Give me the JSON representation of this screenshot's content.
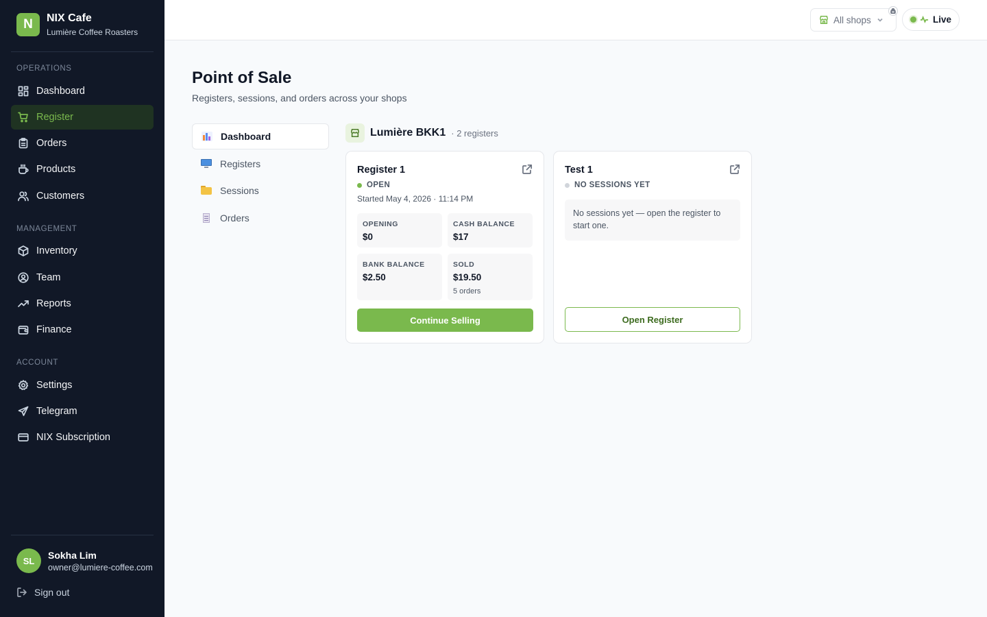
{
  "brand": {
    "logo_letter": "N",
    "name": "NIX Cafe",
    "subtitle": "Lumière Coffee Roasters"
  },
  "sidebar": {
    "sections": [
      {
        "label": "OPERATIONS",
        "items": [
          {
            "label": "Dashboard",
            "icon": "dashboard-icon"
          },
          {
            "label": "Register",
            "icon": "cart-icon",
            "active": true
          },
          {
            "label": "Orders",
            "icon": "clipboard-icon"
          },
          {
            "label": "Products",
            "icon": "coffee-icon"
          },
          {
            "label": "Customers",
            "icon": "users-icon"
          }
        ]
      },
      {
        "label": "MANAGEMENT",
        "items": [
          {
            "label": "Inventory",
            "icon": "box-icon"
          },
          {
            "label": "Team",
            "icon": "user-circle-icon"
          },
          {
            "label": "Reports",
            "icon": "trend-icon"
          },
          {
            "label": "Finance",
            "icon": "wallet-icon"
          }
        ]
      },
      {
        "label": "ACCOUNT",
        "items": [
          {
            "label": "Settings",
            "icon": "gear-icon"
          },
          {
            "label": "Telegram",
            "icon": "send-icon"
          },
          {
            "label": "NIX Subscription",
            "icon": "credit-card-icon"
          }
        ]
      }
    ]
  },
  "user": {
    "initials": "SL",
    "name": "Sokha Lim",
    "email": "owner@lumiere-coffee.com"
  },
  "signout_label": "Sign out",
  "topbar": {
    "shop_select": "All shops",
    "live_label": "Live"
  },
  "page": {
    "title": "Point of Sale",
    "subtitle": "Registers, sessions, and orders across your shops"
  },
  "subnav": [
    {
      "label": "Dashboard",
      "active": true,
      "icon": "bar-chart-icon"
    },
    {
      "label": "Registers",
      "icon": "monitor-icon"
    },
    {
      "label": "Sessions",
      "icon": "folder-icon"
    },
    {
      "label": "Orders",
      "icon": "receipt-icon"
    }
  ],
  "shop": {
    "name": "Lumière BKK1",
    "count": "· 2 registers"
  },
  "registers": [
    {
      "title": "Register 1",
      "status": "OPEN",
      "status_color": "#7ab94d",
      "started": "Started May 4, 2026 · 11:14 PM",
      "stats": [
        {
          "label": "OPENING",
          "value": "$0"
        },
        {
          "label": "CASH BALANCE",
          "value": "$17"
        },
        {
          "label": "BANK BALANCE",
          "value": "$2.50"
        },
        {
          "label": "SOLD",
          "value": "$19.50",
          "note": "5 orders"
        }
      ],
      "button": "Continue Selling"
    },
    {
      "title": "Test 1",
      "status": "NO SESSIONS YET",
      "status_color": "#d1d5db",
      "empty_text": "No sessions yet — open the register to start one.",
      "button": "Open Register"
    }
  ],
  "colors": {
    "accent": "#7ab94d",
    "sidebar_bg": "#111827",
    "page_bg": "#f8fafc"
  }
}
